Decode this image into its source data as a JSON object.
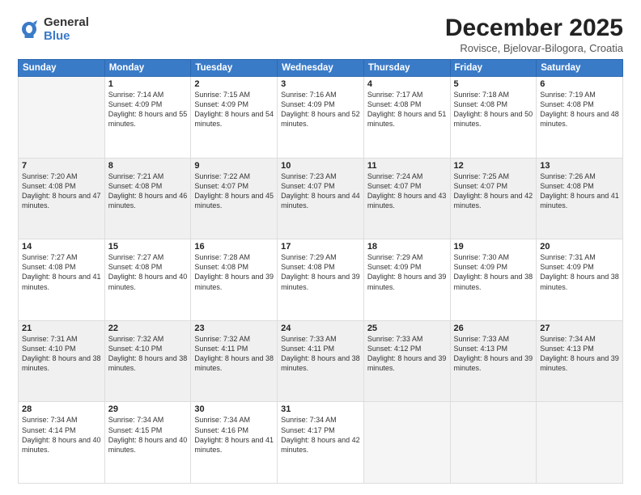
{
  "header": {
    "logo_general": "General",
    "logo_blue": "Blue",
    "month_title": "December 2025",
    "location": "Rovisce, Bjelovar-Bilogora, Croatia"
  },
  "weekdays": [
    "Sunday",
    "Monday",
    "Tuesday",
    "Wednesday",
    "Thursday",
    "Friday",
    "Saturday"
  ],
  "weeks": [
    [
      {
        "day": "",
        "empty": true
      },
      {
        "day": "1",
        "sunrise": "Sunrise: 7:14 AM",
        "sunset": "Sunset: 4:09 PM",
        "daylight": "Daylight: 8 hours and 55 minutes."
      },
      {
        "day": "2",
        "sunrise": "Sunrise: 7:15 AM",
        "sunset": "Sunset: 4:09 PM",
        "daylight": "Daylight: 8 hours and 54 minutes."
      },
      {
        "day": "3",
        "sunrise": "Sunrise: 7:16 AM",
        "sunset": "Sunset: 4:09 PM",
        "daylight": "Daylight: 8 hours and 52 minutes."
      },
      {
        "day": "4",
        "sunrise": "Sunrise: 7:17 AM",
        "sunset": "Sunset: 4:08 PM",
        "daylight": "Daylight: 8 hours and 51 minutes."
      },
      {
        "day": "5",
        "sunrise": "Sunrise: 7:18 AM",
        "sunset": "Sunset: 4:08 PM",
        "daylight": "Daylight: 8 hours and 50 minutes."
      },
      {
        "day": "6",
        "sunrise": "Sunrise: 7:19 AM",
        "sunset": "Sunset: 4:08 PM",
        "daylight": "Daylight: 8 hours and 48 minutes."
      }
    ],
    [
      {
        "day": "7",
        "sunrise": "Sunrise: 7:20 AM",
        "sunset": "Sunset: 4:08 PM",
        "daylight": "Daylight: 8 hours and 47 minutes."
      },
      {
        "day": "8",
        "sunrise": "Sunrise: 7:21 AM",
        "sunset": "Sunset: 4:08 PM",
        "daylight": "Daylight: 8 hours and 46 minutes."
      },
      {
        "day": "9",
        "sunrise": "Sunrise: 7:22 AM",
        "sunset": "Sunset: 4:07 PM",
        "daylight": "Daylight: 8 hours and 45 minutes."
      },
      {
        "day": "10",
        "sunrise": "Sunrise: 7:23 AM",
        "sunset": "Sunset: 4:07 PM",
        "daylight": "Daylight: 8 hours and 44 minutes."
      },
      {
        "day": "11",
        "sunrise": "Sunrise: 7:24 AM",
        "sunset": "Sunset: 4:07 PM",
        "daylight": "Daylight: 8 hours and 43 minutes."
      },
      {
        "day": "12",
        "sunrise": "Sunrise: 7:25 AM",
        "sunset": "Sunset: 4:07 PM",
        "daylight": "Daylight: 8 hours and 42 minutes."
      },
      {
        "day": "13",
        "sunrise": "Sunrise: 7:26 AM",
        "sunset": "Sunset: 4:08 PM",
        "daylight": "Daylight: 8 hours and 41 minutes."
      }
    ],
    [
      {
        "day": "14",
        "sunrise": "Sunrise: 7:27 AM",
        "sunset": "Sunset: 4:08 PM",
        "daylight": "Daylight: 8 hours and 41 minutes."
      },
      {
        "day": "15",
        "sunrise": "Sunrise: 7:27 AM",
        "sunset": "Sunset: 4:08 PM",
        "daylight": "Daylight: 8 hours and 40 minutes."
      },
      {
        "day": "16",
        "sunrise": "Sunrise: 7:28 AM",
        "sunset": "Sunset: 4:08 PM",
        "daylight": "Daylight: 8 hours and 39 minutes."
      },
      {
        "day": "17",
        "sunrise": "Sunrise: 7:29 AM",
        "sunset": "Sunset: 4:08 PM",
        "daylight": "Daylight: 8 hours and 39 minutes."
      },
      {
        "day": "18",
        "sunrise": "Sunrise: 7:29 AM",
        "sunset": "Sunset: 4:09 PM",
        "daylight": "Daylight: 8 hours and 39 minutes."
      },
      {
        "day": "19",
        "sunrise": "Sunrise: 7:30 AM",
        "sunset": "Sunset: 4:09 PM",
        "daylight": "Daylight: 8 hours and 38 minutes."
      },
      {
        "day": "20",
        "sunrise": "Sunrise: 7:31 AM",
        "sunset": "Sunset: 4:09 PM",
        "daylight": "Daylight: 8 hours and 38 minutes."
      }
    ],
    [
      {
        "day": "21",
        "sunrise": "Sunrise: 7:31 AM",
        "sunset": "Sunset: 4:10 PM",
        "daylight": "Daylight: 8 hours and 38 minutes."
      },
      {
        "day": "22",
        "sunrise": "Sunrise: 7:32 AM",
        "sunset": "Sunset: 4:10 PM",
        "daylight": "Daylight: 8 hours and 38 minutes."
      },
      {
        "day": "23",
        "sunrise": "Sunrise: 7:32 AM",
        "sunset": "Sunset: 4:11 PM",
        "daylight": "Daylight: 8 hours and 38 minutes."
      },
      {
        "day": "24",
        "sunrise": "Sunrise: 7:33 AM",
        "sunset": "Sunset: 4:11 PM",
        "daylight": "Daylight: 8 hours and 38 minutes."
      },
      {
        "day": "25",
        "sunrise": "Sunrise: 7:33 AM",
        "sunset": "Sunset: 4:12 PM",
        "daylight": "Daylight: 8 hours and 39 minutes."
      },
      {
        "day": "26",
        "sunrise": "Sunrise: 7:33 AM",
        "sunset": "Sunset: 4:13 PM",
        "daylight": "Daylight: 8 hours and 39 minutes."
      },
      {
        "day": "27",
        "sunrise": "Sunrise: 7:34 AM",
        "sunset": "Sunset: 4:13 PM",
        "daylight": "Daylight: 8 hours and 39 minutes."
      }
    ],
    [
      {
        "day": "28",
        "sunrise": "Sunrise: 7:34 AM",
        "sunset": "Sunset: 4:14 PM",
        "daylight": "Daylight: 8 hours and 40 minutes."
      },
      {
        "day": "29",
        "sunrise": "Sunrise: 7:34 AM",
        "sunset": "Sunset: 4:15 PM",
        "daylight": "Daylight: 8 hours and 40 minutes."
      },
      {
        "day": "30",
        "sunrise": "Sunrise: 7:34 AM",
        "sunset": "Sunset: 4:16 PM",
        "daylight": "Daylight: 8 hours and 41 minutes."
      },
      {
        "day": "31",
        "sunrise": "Sunrise: 7:34 AM",
        "sunset": "Sunset: 4:17 PM",
        "daylight": "Daylight: 8 hours and 42 minutes."
      },
      {
        "day": "",
        "empty": true
      },
      {
        "day": "",
        "empty": true
      },
      {
        "day": "",
        "empty": true
      }
    ]
  ]
}
